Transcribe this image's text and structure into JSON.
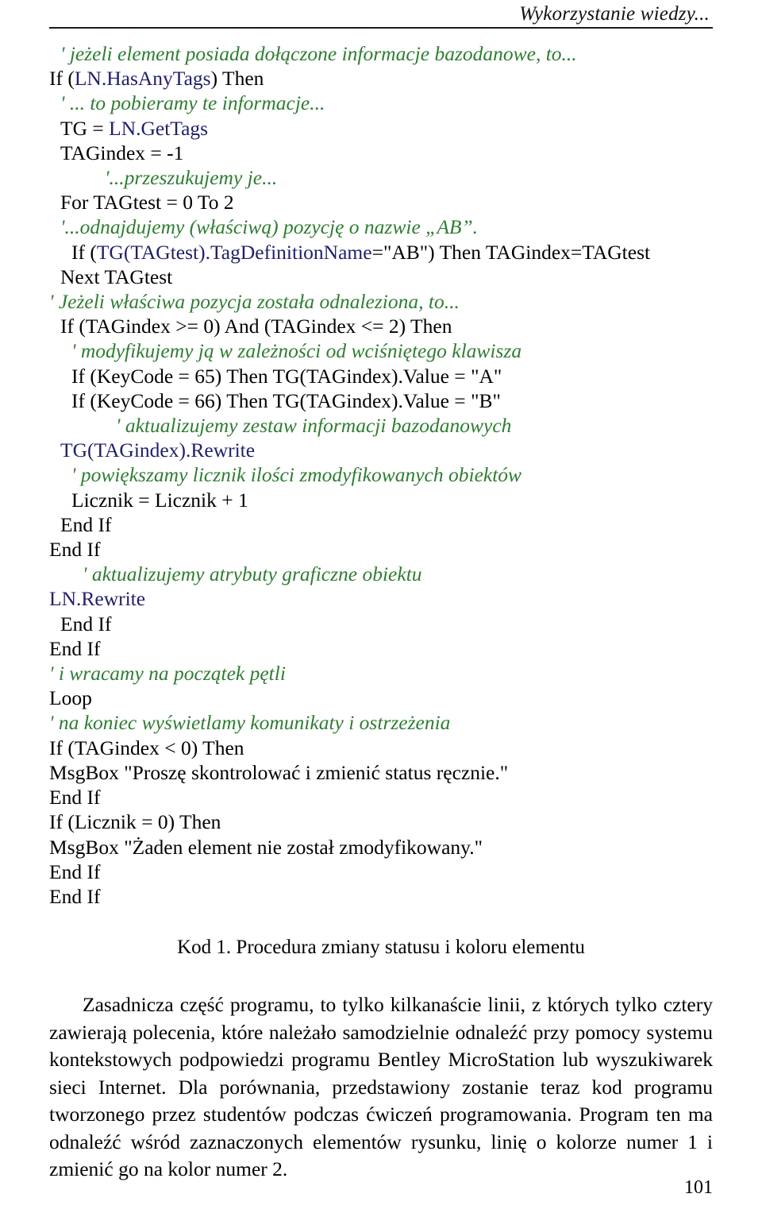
{
  "header": {
    "title": "Wykorzystanie wiedzy..."
  },
  "code_listing": {
    "lines": [
      {
        "indent": 1,
        "spans": [
          {
            "style": "comment",
            "text": "' jeżeli element posiada dołączone informacje bazodanowe, to..."
          }
        ]
      },
      {
        "indent": 0,
        "spans": [
          {
            "style": "plain",
            "text": "If ("
          },
          {
            "style": "object",
            "text": "LN.HasAnyTags"
          },
          {
            "style": "plain",
            "text": ") Then"
          }
        ]
      },
      {
        "indent": 1,
        "spans": [
          {
            "style": "comment",
            "text": "' ... to pobieramy te informacje..."
          }
        ]
      },
      {
        "indent": 1,
        "spans": [
          {
            "style": "plain",
            "text": "TG = "
          },
          {
            "style": "object",
            "text": "LN.GetTags"
          }
        ]
      },
      {
        "indent": 1,
        "spans": [
          {
            "style": "plain",
            "text": "TAGindex = -1"
          }
        ]
      },
      {
        "indent": 5,
        "spans": [
          {
            "style": "comment",
            "text": "'...przeszukujemy je..."
          }
        ]
      },
      {
        "indent": 1,
        "spans": [
          {
            "style": "plain",
            "text": "For TAGtest = 0 To 2"
          }
        ]
      },
      {
        "indent": 1,
        "spans": [
          {
            "style": "comment",
            "text": "'...odnajdujemy (właściwą) pozycję o nazwie „AB”."
          }
        ]
      },
      {
        "indent": 2,
        "spans": [
          {
            "style": "plain",
            "text": "If ("
          },
          {
            "style": "object",
            "text": "TG(TAGtest).TagDefinitionName"
          },
          {
            "style": "plain",
            "text": "=\"AB\") Then TAGindex=TAGtest"
          }
        ]
      },
      {
        "indent": 1,
        "spans": [
          {
            "style": "plain",
            "text": "Next TAGtest"
          }
        ]
      },
      {
        "indent": 0,
        "spans": [
          {
            "style": "comment",
            "text": "' Jeżeli właściwa pozycja została odnaleziona, to..."
          }
        ]
      },
      {
        "indent": 1,
        "spans": [
          {
            "style": "plain",
            "text": "If (TAGindex >= 0) And (TAGindex <= 2) Then"
          }
        ]
      },
      {
        "indent": 2,
        "spans": [
          {
            "style": "comment",
            "text": "' modyfikujemy ją w zależności od wciśniętego klawisza"
          }
        ]
      },
      {
        "indent": 2,
        "spans": [
          {
            "style": "plain",
            "text": "If (KeyCode = 65) Then TG(TAGindex).Value = \"A\""
          }
        ]
      },
      {
        "indent": 2,
        "spans": [
          {
            "style": "plain",
            "text": "If (KeyCode = 66) Then TG(TAGindex).Value = \"B\""
          }
        ]
      },
      {
        "indent": 6,
        "spans": [
          {
            "style": "comment",
            "text": "' aktualizujemy zestaw informacji bazodanowych"
          }
        ]
      },
      {
        "indent": 1,
        "spans": [
          {
            "style": "object",
            "text": "TG(TAGindex).Rewrite"
          }
        ]
      },
      {
        "indent": 2,
        "spans": [
          {
            "style": "comment",
            "text": "' powiększamy licznik ilości zmodyfikowanych obiektów"
          }
        ]
      },
      {
        "indent": 2,
        "spans": [
          {
            "style": "plain",
            "text": "Licznik = Licznik + 1"
          }
        ]
      },
      {
        "indent": 1,
        "spans": [
          {
            "style": "plain",
            "text": "End If"
          }
        ]
      },
      {
        "indent": 0,
        "spans": [
          {
            "style": "plain",
            "text": "End If"
          }
        ]
      },
      {
        "indent": 3,
        "spans": [
          {
            "style": "comment",
            "text": "' aktualizujemy atrybuty graficzne obiektu"
          }
        ]
      },
      {
        "indent": 0,
        "spans": [
          {
            "style": "object",
            "text": "LN.Rewrite"
          }
        ]
      },
      {
        "indent": 1,
        "spans": [
          {
            "style": "plain",
            "text": "End If"
          }
        ]
      },
      {
        "indent": 0,
        "spans": [
          {
            "style": "plain",
            "text": "End If"
          }
        ]
      },
      {
        "indent": -1,
        "spans": [
          {
            "style": "comment",
            "text": "' i wracamy na początek pętli"
          }
        ]
      },
      {
        "indent": -1,
        "spans": [
          {
            "style": "plain",
            "text": "Loop"
          }
        ]
      },
      {
        "indent": -1,
        "spans": [
          {
            "style": "comment",
            "text": "' na koniec wyświetlamy komunikaty i ostrzeżenia"
          }
        ]
      },
      {
        "indent": -1,
        "spans": [
          {
            "style": "plain",
            "text": "If (TAGindex < 0) Then"
          }
        ]
      },
      {
        "indent": 0,
        "spans": [
          {
            "style": "plain",
            "text": "MsgBox \"Proszę skontrolować i zmienić status ręcznie.\""
          }
        ]
      },
      {
        "indent": -1,
        "spans": [
          {
            "style": "plain",
            "text": "End If"
          }
        ]
      },
      {
        "indent": -1,
        "spans": [
          {
            "style": "plain",
            "text": "If (Licznik = 0) Then"
          }
        ]
      },
      {
        "indent": 0,
        "spans": [
          {
            "style": "plain",
            "text": "MsgBox \"Żaden element nie został zmodyfikowany.\""
          }
        ]
      },
      {
        "indent": -1,
        "spans": [
          {
            "style": "plain",
            "text": "End If"
          }
        ]
      },
      {
        "indent": -2,
        "spans": [
          {
            "style": "plain",
            "text": "End If"
          }
        ]
      }
    ]
  },
  "caption": {
    "text": "Kod 1. Procedura zmiany statusu i koloru elementu"
  },
  "body": {
    "paragraph": "Zasadnicza część programu, to tylko kilkanaście linii, z których tylko cztery zawierają polecenia, które należało samodzielnie odnaleźć przy pomocy systemu kontekstowych podpowiedzi programu Bentley MicroStation lub wyszukiwarek sieci Internet. Dla porównania, przedstawiony zostanie teraz kod programu tworzonego przez studentów podczas ćwiczeń programowania. Program ten ma odnaleźć wśród zaznaczonych elementów rysunku, linię o kolorze numer 1 i zmienić go na kolor numer 2."
  },
  "footer": {
    "page_number": "101"
  },
  "colors": {
    "comment_green": "#2e7d32",
    "object_blue": "#20206b",
    "text_black": "#000000"
  }
}
